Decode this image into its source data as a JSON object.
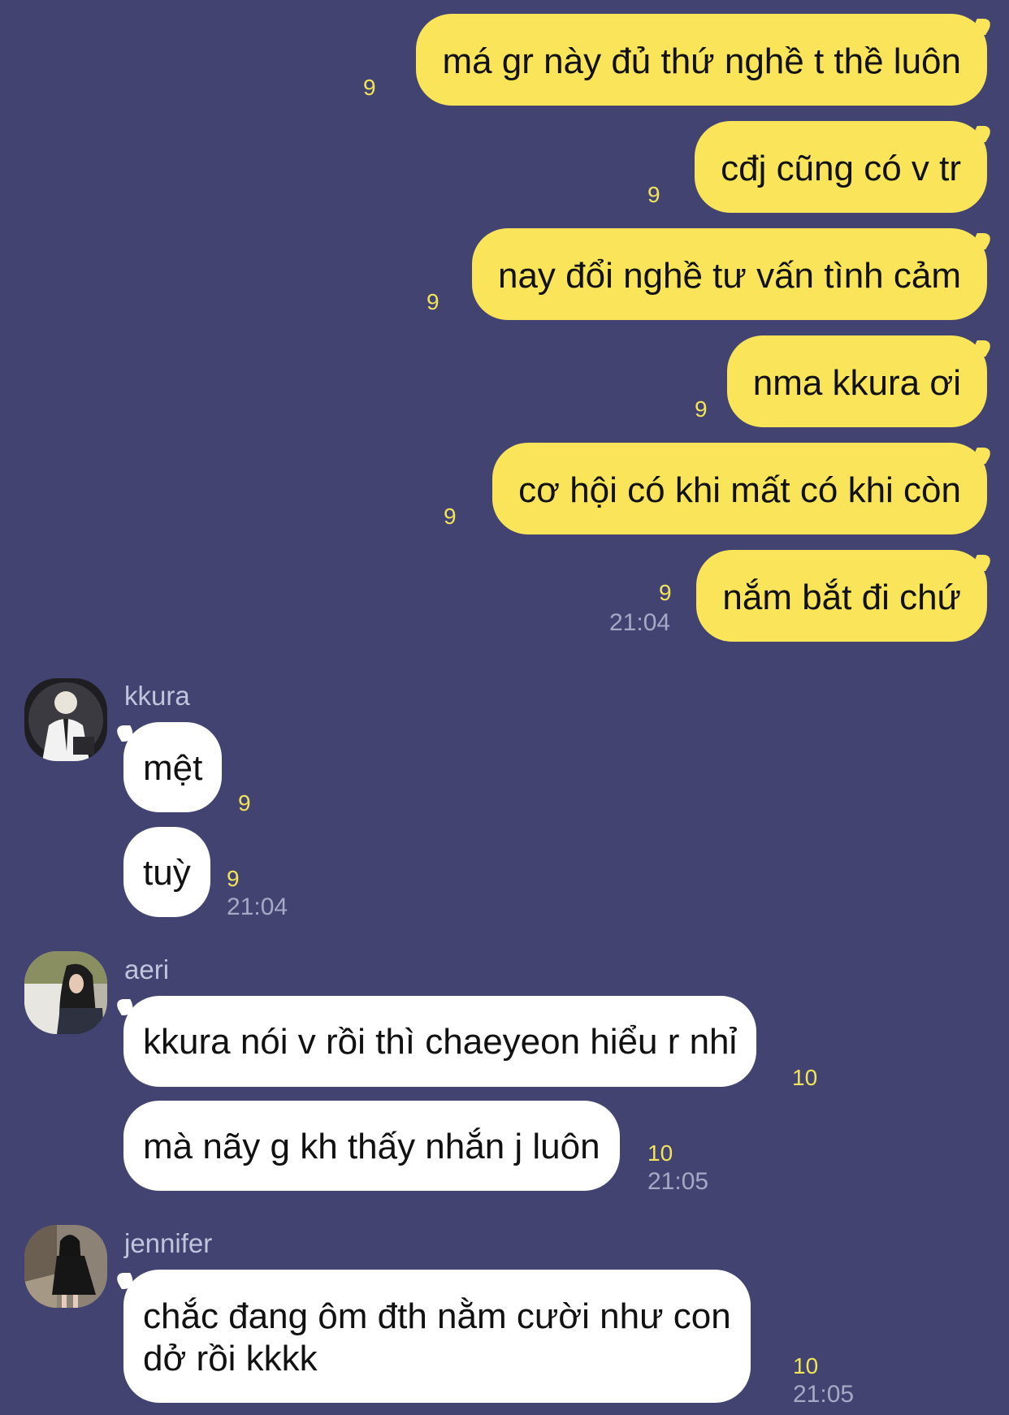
{
  "outgoing": [
    {
      "text": "má gr này đủ thứ nghề t thề luôn",
      "unread": "9"
    },
    {
      "text": "cđj cũng có v tr",
      "unread": "9"
    },
    {
      "text": "nay đổi nghề tư vấn tình cảm",
      "unread": "9"
    },
    {
      "text": "nma kkura ơi",
      "unread": "9"
    },
    {
      "text": "cơ hội có khi mất có khi còn",
      "unread": "9"
    },
    {
      "text": "nắm bắt đi chứ",
      "unread": "9",
      "time": "21:04"
    }
  ],
  "groups": [
    {
      "sender": "kkura",
      "avatar_icon": "avatar-kkura-photo",
      "messages": [
        {
          "text": "mệt",
          "unread": "9"
        },
        {
          "text": "tuỳ",
          "unread": "9",
          "time": "21:04"
        }
      ]
    },
    {
      "sender": "aeri",
      "avatar_icon": "avatar-aeri-photo",
      "messages": [
        {
          "text": "kkura nói v rồi thì chaeyeon hiểu r nhỉ",
          "unread": "10"
        },
        {
          "text": "mà nãy g kh thấy nhắn j luôn",
          "unread": "10",
          "time": "21:05"
        }
      ]
    },
    {
      "sender": "jennifer",
      "avatar_icon": "avatar-jennifer-photo",
      "messages": [
        {
          "text_line1": "chắc đang ôm đth nằm cười như con",
          "text_line2": "dở rồi kkkk",
          "unread": "10",
          "time": "21:05"
        }
      ]
    }
  ],
  "colors": {
    "background": "#424371",
    "outgoing_bubble": "#f9e45a",
    "incoming_bubble": "#ffffff",
    "unread_count": "#f2e45a",
    "timestamp": "#a7a8c6"
  }
}
